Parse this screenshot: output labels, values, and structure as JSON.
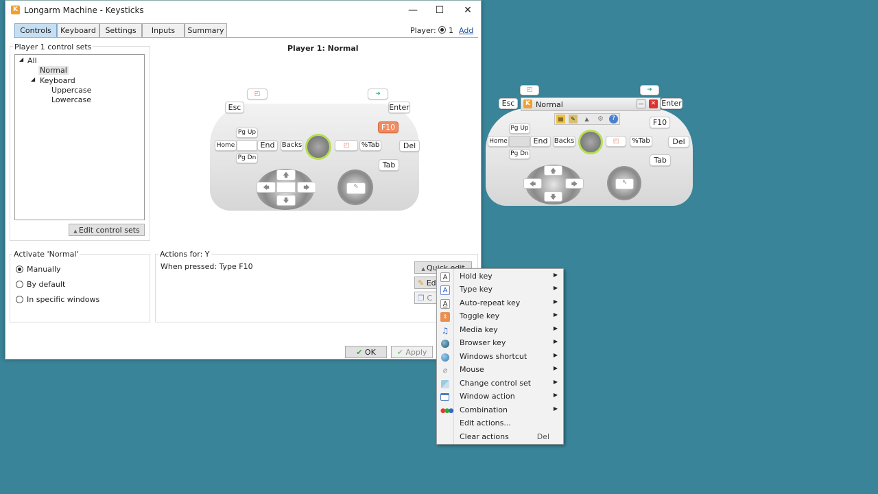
{
  "window": {
    "title": "Longarm Machine - Keysticks",
    "icon_letter": "K",
    "minimize": "—",
    "maximize": "☐",
    "close": "✕"
  },
  "tabs": [
    {
      "label": "Controls"
    },
    {
      "label": "Keyboard"
    },
    {
      "label": "Settings"
    },
    {
      "label": "Inputs"
    },
    {
      "label": "Summary"
    }
  ],
  "player": {
    "label": "Player:",
    "value": "1",
    "add": "Add"
  },
  "control_sets": {
    "group_label": "Player 1 control sets",
    "tree": [
      "All",
      "Normal",
      "Keyboard",
      "Uppercase",
      "Lowercase"
    ],
    "edit_button": "Edit control sets"
  },
  "preview": {
    "title": "Player 1: Normal"
  },
  "controller": {
    "esc": "Esc",
    "enter": "Enter",
    "f10": "F10",
    "pgup": "Pg Up",
    "pgdn": "Pg Dn",
    "home": "Home",
    "end": "End",
    "backs": "Backs",
    "tab_pct": "%Tab",
    "del": "Del",
    "tab": "Tab"
  },
  "activate": {
    "group_label": "Activate 'Normal'",
    "options": [
      "Manually",
      "By default",
      "In specific windows"
    ],
    "selected": "Manually"
  },
  "actions": {
    "group_label": "Actions for: Y",
    "text": "When pressed: Type F10",
    "quick_edit": "Quick edit",
    "edit_partial": "Ed",
    "copy_partial": "C"
  },
  "footer": {
    "ok": "OK",
    "apply": "Apply"
  },
  "menu": {
    "items": [
      {
        "label": "Hold key",
        "icon": "letter-a-icon"
      },
      {
        "label": "Type key",
        "icon": "letter-a-icon"
      },
      {
        "label": "Auto-repeat key",
        "icon": "letter-a-icon"
      },
      {
        "label": "Toggle key",
        "icon": "toggle-icon"
      },
      {
        "label": "Media key",
        "icon": "music-note-icon"
      },
      {
        "label": "Browser key",
        "icon": "globe-icon"
      },
      {
        "label": "Windows shortcut",
        "icon": "windows-icon"
      },
      {
        "label": "Mouse",
        "icon": "mouse-icon"
      },
      {
        "label": "Change control set",
        "icon": "control-set-icon"
      },
      {
        "label": "Window action",
        "icon": "window-icon"
      },
      {
        "label": "Combination",
        "icon": "combination-icon"
      },
      {
        "label": "Edit actions...",
        "icon": ""
      },
      {
        "label": "Clear actions",
        "icon": "",
        "shortcut": "Del"
      }
    ]
  },
  "floating": {
    "title": "Normal",
    "esc": "Esc",
    "enter": "Enter",
    "f10": "F10",
    "pgup": "Pg Up",
    "pgdn": "Pg Dn",
    "home": "Home",
    "end": "End",
    "backs": "Backs",
    "tab_pct": "%Tab",
    "del": "Del",
    "tab": "Tab"
  },
  "colors": {
    "accent": "#c5def2",
    "highlight_key": "#f08a60",
    "desktop": "#3a8499",
    "ring": "#b8dd54"
  }
}
